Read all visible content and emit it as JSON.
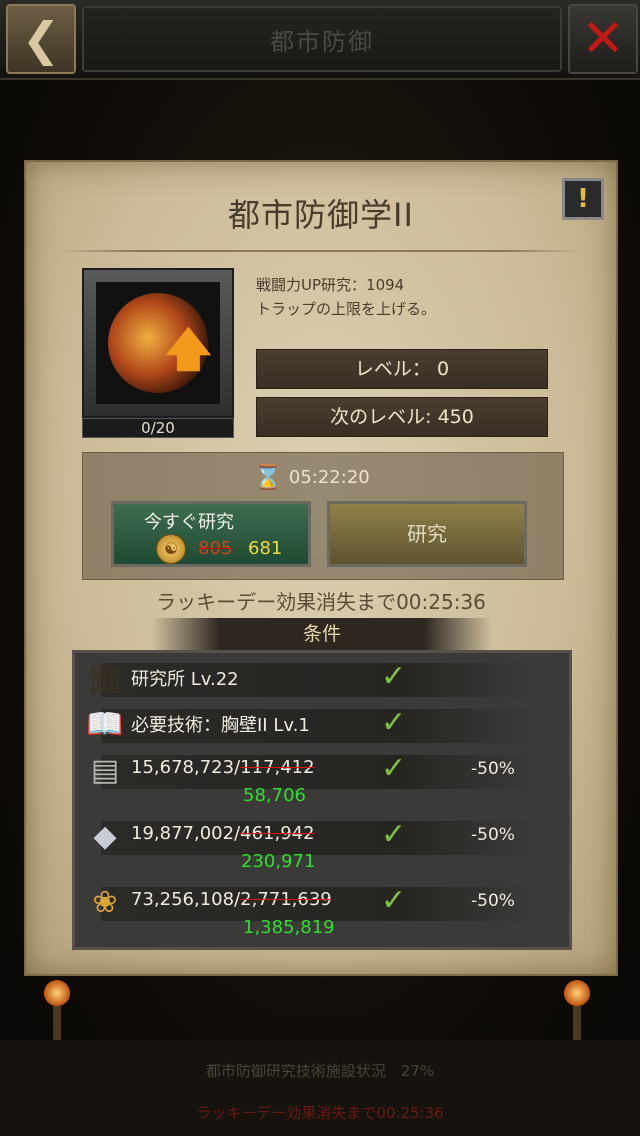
{
  "background": {
    "title": "都市防御",
    "bottom_line1": "都市防御研究技術施設状況　27%",
    "bottom_line2": "ラッキーデー効果消失まで00:25:36"
  },
  "dialog": {
    "title": "都市防御学II",
    "info_label": "!",
    "progress": "0/20",
    "description_line1": "戦闘力UP研究：1094",
    "description_line2": "トラップの上限を上げる。",
    "level_label": "レベル： 0",
    "next_level_label": "次のレベル: 450",
    "timer": "05:22:20",
    "research_now_label": "今すぐ研究",
    "price_old": "805",
    "price_new": "681",
    "research_label": "研究",
    "lucky_text": "ラッキーデー効果消失まで00:25:36",
    "conditions_title": "条件"
  },
  "conditions": [
    {
      "icon": "lab-building-icon",
      "text": "研究所 Lv.22",
      "met": true
    },
    {
      "icon": "book-icon",
      "text": "必要技術：胸壁II Lv.1",
      "met": true
    },
    {
      "icon": "stone-icon",
      "have": "15,678,723",
      "sep": "/",
      "need_old": "117,412",
      "need_new": "58,706",
      "discount": "-50%",
      "met": true
    },
    {
      "icon": "iron-ore-icon",
      "have": "19,877,002",
      "sep": "/",
      "need_old": "461,942",
      "need_new": "230,971",
      "discount": "-50%",
      "met": true
    },
    {
      "icon": "wheat-icon",
      "have": "73,256,108",
      "sep": "/",
      "need_old": "2,771,639",
      "need_new": "1,385,819",
      "discount": "-50%",
      "met": true
    }
  ],
  "colors": {
    "accent_gold": "#f1da3a",
    "requirement_met": "#7fc241",
    "discount_green": "#2ee02e",
    "strike_red": "#e01010"
  }
}
